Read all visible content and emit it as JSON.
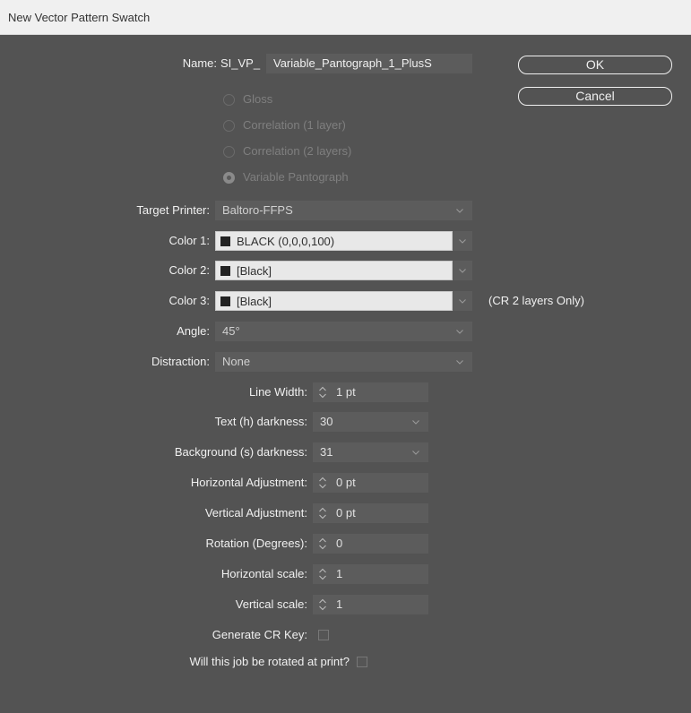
{
  "window": {
    "title": "New Vector Pattern Swatch"
  },
  "name": {
    "label": "Name:",
    "prefix": "SI_VP_",
    "value": "Variable_Pantograph_1_PlusS"
  },
  "buttons": {
    "ok": "OK",
    "cancel": "Cancel"
  },
  "pattern_types": [
    {
      "label": "Gloss",
      "selected": false
    },
    {
      "label": "Correlation (1 layer)",
      "selected": false
    },
    {
      "label": "Correlation (2 layers)",
      "selected": false
    },
    {
      "label": "Variable Pantograph",
      "selected": true
    }
  ],
  "target_printer": {
    "label": "Target Printer:",
    "value": "Baltoro-FFPS"
  },
  "color1": {
    "label": "Color 1:",
    "value": "BLACK (0,0,0,100)"
  },
  "color2": {
    "label": "Color 2:",
    "value": "[Black]"
  },
  "color3": {
    "label": "Color 3:",
    "value": "[Black]",
    "note": "(CR 2 layers Only)"
  },
  "angle": {
    "label": "Angle:",
    "value": "45°"
  },
  "distraction": {
    "label": "Distraction:",
    "value": "None"
  },
  "line_width": {
    "label": "Line Width:",
    "value": "1 pt"
  },
  "text_darkness": {
    "label": "Text (h) darkness:",
    "value": "30"
  },
  "background_darkness": {
    "label": "Background (s) darkness:",
    "value": "31"
  },
  "horizontal_adjustment": {
    "label": "Horizontal Adjustment:",
    "value": "0 pt"
  },
  "vertical_adjustment": {
    "label": "Vertical Adjustment:",
    "value": "0 pt"
  },
  "rotation": {
    "label": "Rotation (Degrees):",
    "value": "0"
  },
  "horizontal_scale": {
    "label": "Horizontal scale:",
    "value": "1"
  },
  "vertical_scale": {
    "label": "Vertical scale:",
    "value": "1"
  },
  "generate_cr_key": {
    "label": "Generate CR Key:",
    "checked": false
  },
  "rotated_at_print": {
    "label": "Will this job be rotated at print?",
    "checked": false
  },
  "colors": {
    "dialog_bg": "#535353",
    "field_bg": "#5c5c5c",
    "titlebar_bg": "#f0f0f0",
    "text": "#f0f0f0"
  }
}
